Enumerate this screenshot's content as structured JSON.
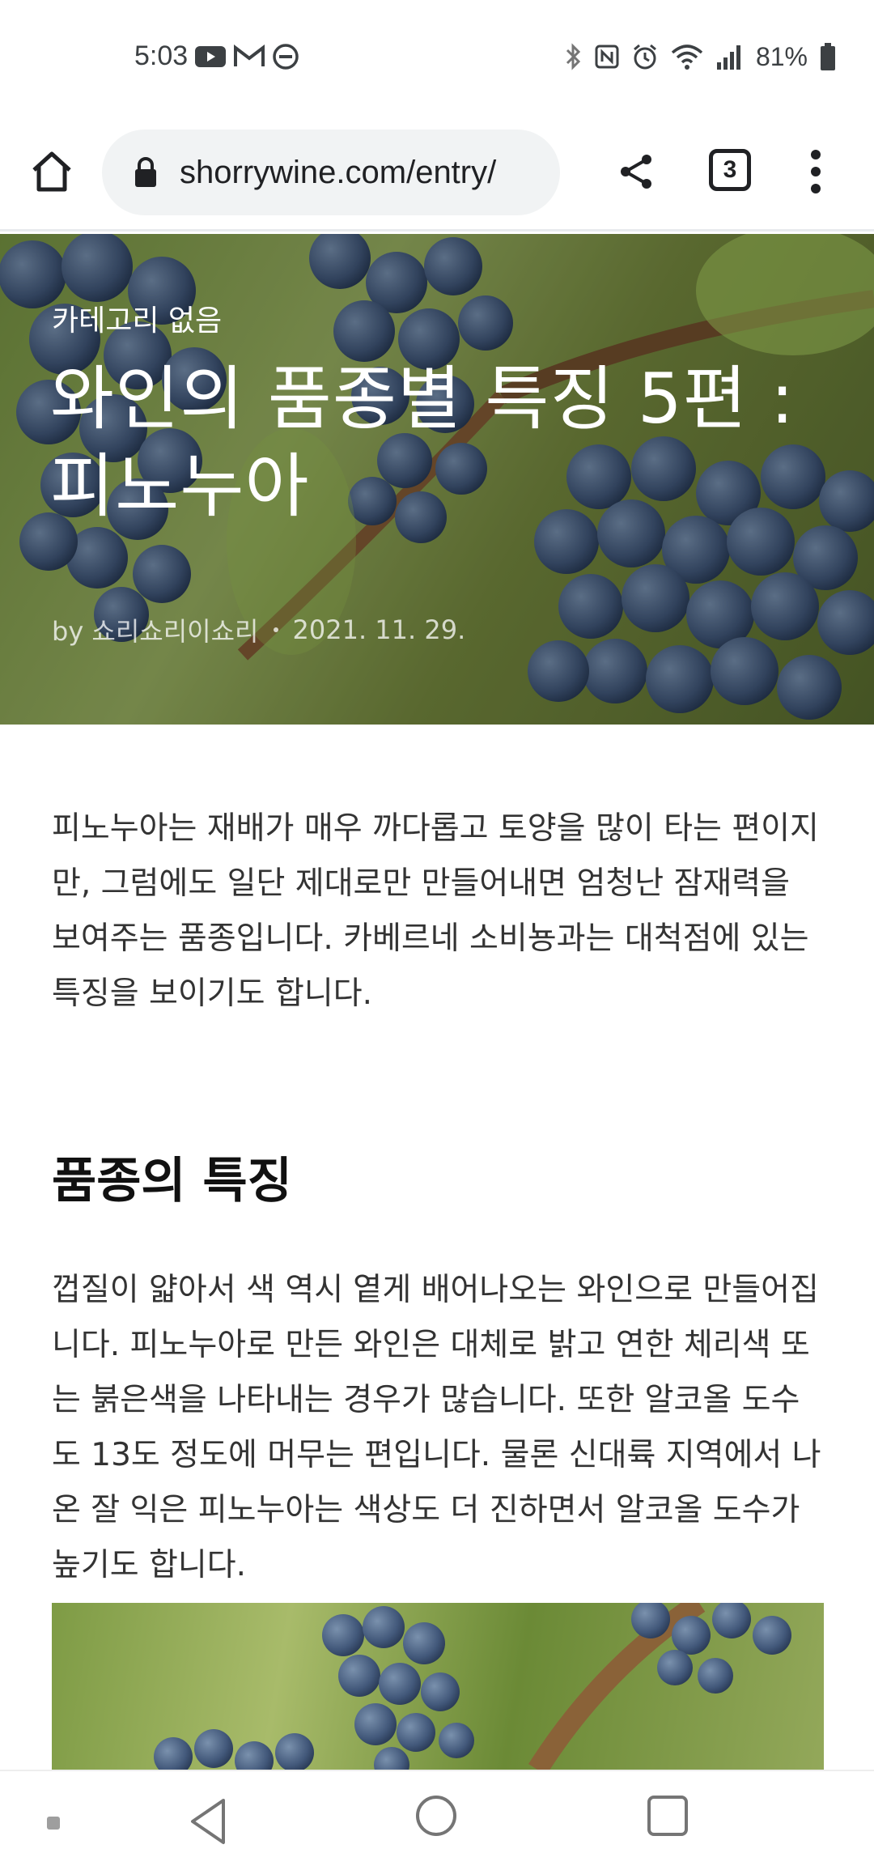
{
  "status_bar": {
    "time": "5:03",
    "battery_percent": "81%",
    "left_icons": [
      "youtube-icon",
      "gmail-icon",
      "dnd-icon"
    ],
    "right_icons": [
      "bluetooth-icon",
      "nfc-icon",
      "alarm-icon",
      "wifi-icon",
      "signal-icon",
      "battery-icon"
    ]
  },
  "toolbar": {
    "url": "shorrywine.com/entry/",
    "tab_count": "3"
  },
  "hero": {
    "category": "카테고리 없음",
    "title": "와인의 품종별 특징 5편 : 피노누아",
    "author": "by 쇼리쇼리이쇼리",
    "date": "2021. 11. 29."
  },
  "article": {
    "intro": "피노누아는 재배가 매우 까다롭고 토양을 많이 타는 편이지만, 그럼에도 일단 제대로만 만들어내면 엄청난 잠재력을 보여주는 품종입니다. 카베르네 소비뇽과는 대척점에 있는 특징을 보이기도 합니다.",
    "section_heading": "품종의 특징",
    "section_body": "껍질이 얇아서 색 역시 옅게 배어나오는 와인으로 만들어집니다. 피노누아로 만든 와인은 대체로 밝고 연한 체리색 또는 붉은색을 나타내는 경우가 많습니다. 또한 알코올 도수도 13도 정도에 머무는 편입니다. 물론 신대륙 지역에서 나온 잘 익은 피노누아는 색상도 더 진하면서 알코올 도수가 높기도 합니다."
  },
  "colors": {
    "accent": "#202124",
    "omnibox_bg": "#f1f3f4",
    "grape": "#3f5675"
  }
}
